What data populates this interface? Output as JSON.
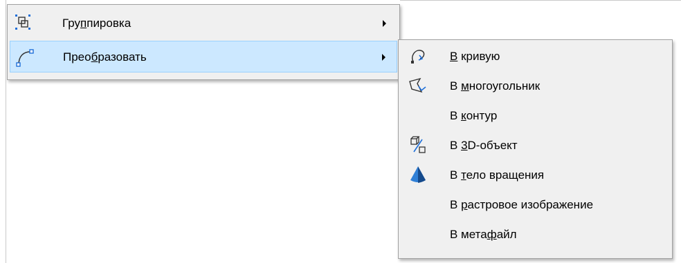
{
  "menu": {
    "items": [
      {
        "label_pre": "Гру",
        "label_key": "п",
        "label_post": "пировка",
        "icon": "group-icon",
        "has_submenu": true,
        "highlighted": false
      },
      {
        "label_pre": "Прео",
        "label_key": "б",
        "label_post": "разовать",
        "icon": "bezier-curve-icon",
        "has_submenu": true,
        "highlighted": true
      }
    ]
  },
  "submenu": {
    "items": [
      {
        "label_pre": "",
        "label_key": "В",
        "label_post": " кривую",
        "icon": "to-curve-icon"
      },
      {
        "label_pre": "В ",
        "label_key": "м",
        "label_post": "ногоугольник",
        "icon": "to-polygon-icon"
      },
      {
        "label_pre": "В ",
        "label_key": "к",
        "label_post": "онтур",
        "icon": ""
      },
      {
        "label_pre": "В ",
        "label_key": "3",
        "label_post": "D-объект",
        "icon": "to-3d-object-icon"
      },
      {
        "label_pre": "В ",
        "label_key": "т",
        "label_post": "ело вращения",
        "icon": "rotation-body-icon"
      },
      {
        "label_pre": "В ",
        "label_key": "р",
        "label_post": "астровое изображение",
        "icon": ""
      },
      {
        "label_pre": "В мета",
        "label_key": "ф",
        "label_post": "айл",
        "icon": ""
      }
    ]
  },
  "colors": {
    "menu_background": "#f0f0f0",
    "highlight_background": "#cce8ff",
    "highlight_border": "#99d1ff",
    "icon_accent": "#1e6fd9"
  }
}
